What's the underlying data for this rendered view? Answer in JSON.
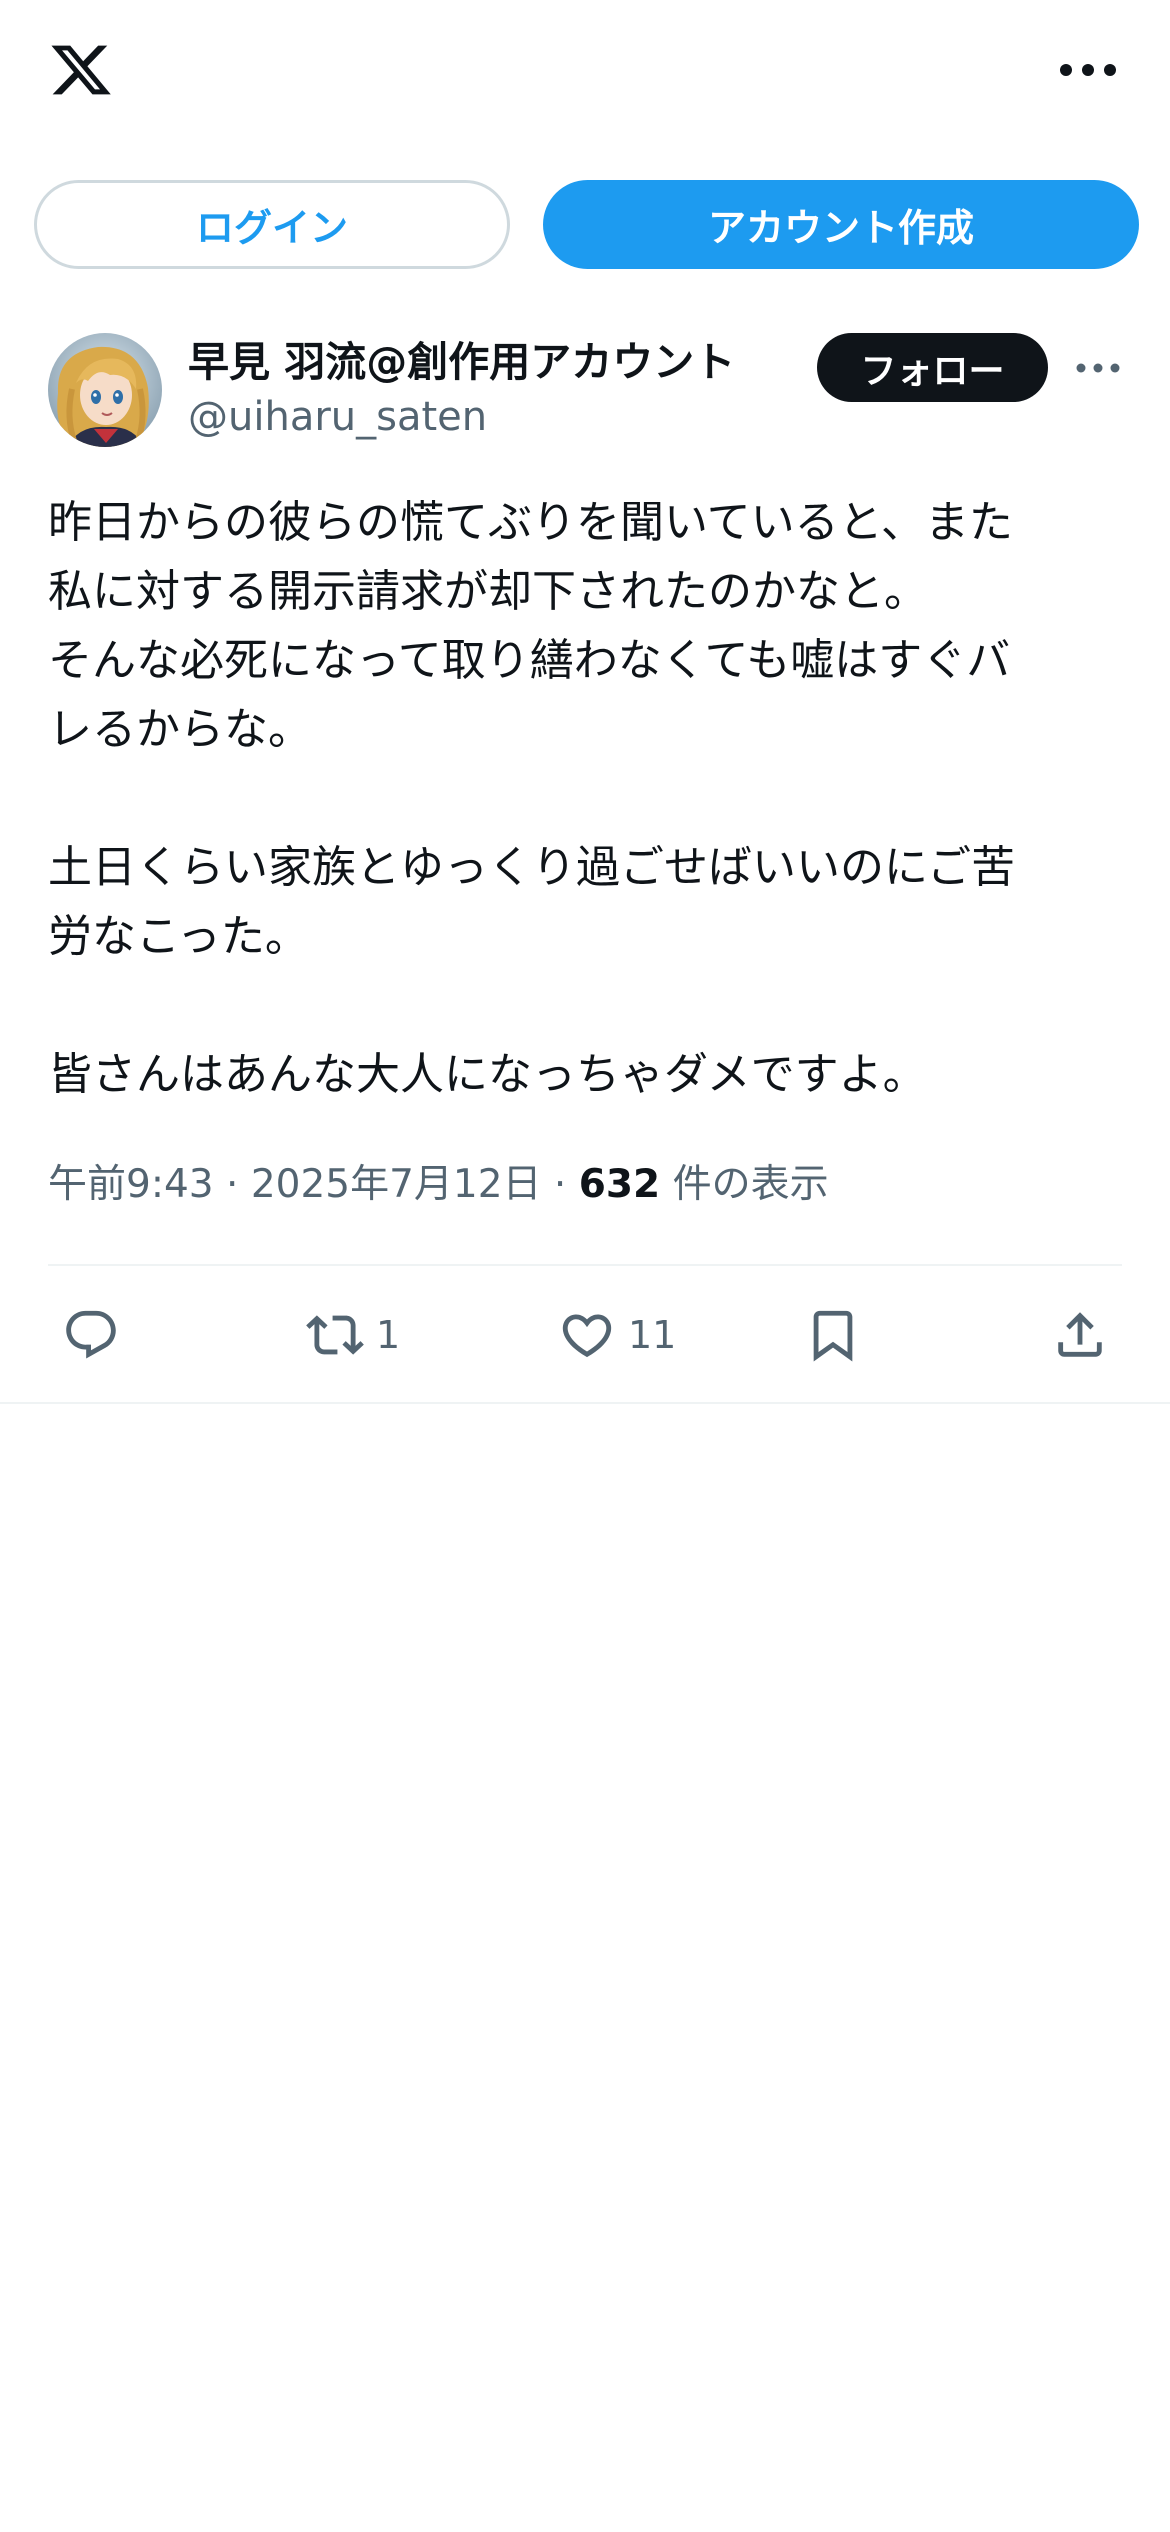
{
  "header": {
    "logo_icon": "x-logo-icon",
    "more_icon": "more-horizontal-icon"
  },
  "auth": {
    "login_label": "ログイン",
    "signup_label": "アカウント作成"
  },
  "post": {
    "author": {
      "display_name": "早見 羽流@創作用アカウント",
      "handle": "@uiharu_saten"
    },
    "follow_label": "フォロー",
    "text_lines": [
      "昨日からの彼らの慌てぶりを聞いていると、また",
      "私に対する開示請求が却下されたのかなと。",
      "そんな必死になって取り繕わなくても嘘はすぐバ",
      "レるからな。",
      "",
      "土日くらい家族とゆっくり過ごせばいいのにご苦",
      "労なこった。",
      "",
      "皆さんはあんな大人になっちゃダメですよ。"
    ],
    "time": "午前9:43",
    "separator": "·",
    "date": "2025年7月12日",
    "views_count": "632",
    "views_label": "件の表示"
  },
  "actions": {
    "reply_icon": "reply-icon",
    "repost_icon": "repost-icon",
    "repost_count": "1",
    "like_icon": "heart-icon",
    "like_count": "11",
    "bookmark_icon": "bookmark-icon",
    "share_icon": "share-icon"
  },
  "colors": {
    "accent": "#1d9bf0",
    "text": "#0f1419",
    "secondary_text": "#536471",
    "border": "#cfd9de",
    "divider": "#eff3f4"
  }
}
